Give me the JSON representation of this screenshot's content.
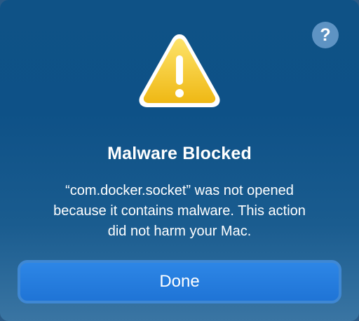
{
  "dialog": {
    "help_label": "?",
    "icon": "warning-triangle-icon",
    "title": "Malware Blocked",
    "message_lines": [
      "“com.docker.socket” was not opened",
      "because it contains malware. This action",
      "did not harm your Mac."
    ],
    "done_label": "Done"
  },
  "colors": {
    "background": "#0e5187",
    "accent": "#1f74d6",
    "warning": "#f5c518"
  }
}
